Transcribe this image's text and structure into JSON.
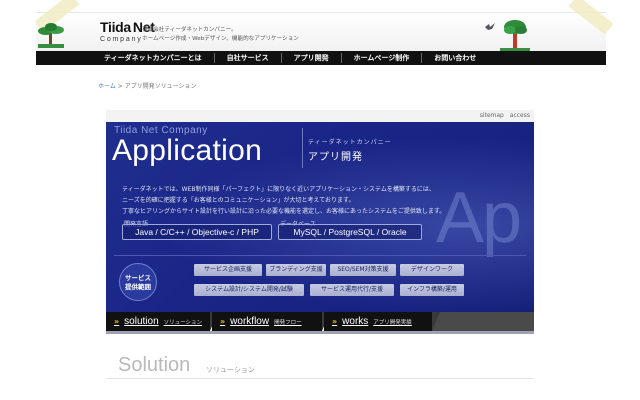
{
  "header": {
    "logo_main_1": "Tiida",
    "logo_main_2": "Net",
    "logo_sub": "Company",
    "tagline_1": "有限会社ティーダネットカンパニー。",
    "tagline_2": "ホームページ作成・Webデザイン、機能的なアプリケーション"
  },
  "nav": {
    "items": [
      "ティーダネットカンパニーとは",
      "自社サービス",
      "アプリ開発",
      "ホームページ制作",
      "お問い合わせ"
    ]
  },
  "breadcrumb": {
    "home": "ホーム",
    "separator": " > ",
    "current": "アプリ開発ソリューション"
  },
  "hero": {
    "utility_links": [
      "sitemap",
      "access"
    ],
    "brand": "Tiida Net Company",
    "title": "Application",
    "subtitle_kana": "ティーダネットカンパニー",
    "subtitle": "アプリ開発",
    "watermark": "Ap",
    "description": [
      "ティーダネットでは、WEB制作同様「パーフェクト」に限りなく近いアプリケーション・システムを構築するには、",
      "ニーズを的確に把握する「お客様とのコミュニケーション」が大切と考えております。",
      "丁寧なヒアリングからサイト設計を行い設計に沿った必要な機能を選定し、お客様にあったシステムをご提供致します。"
    ],
    "languages_label": "開発言語",
    "languages": "Java / C/C++ / Objective-c / PHP",
    "database_label": "データベース",
    "database": "MySQL / PostgreSQL / Oracle",
    "service_badge_1": "サービス",
    "service_badge_2": "提供範囲",
    "services_row1": [
      "サービス企画支援",
      "ブランディング支援",
      "SEO/SEM対策支援",
      "デザインワーク"
    ],
    "services_row2": [
      "システム設計/システム開発/試験",
      "サービス運用代行/支援",
      "インフラ構築/運用"
    ]
  },
  "tabs": [
    {
      "en": "solution",
      "jp": "ソリューション"
    },
    {
      "en": "workflow",
      "jp": "開発フロー"
    },
    {
      "en": "works",
      "jp": "アプリ開発実績"
    }
  ],
  "section": {
    "title": "Solution",
    "title_jp": "ソリューション"
  },
  "colors": {
    "hero_blue": "#1a2687",
    "nav_black": "#111111",
    "accent_yellow": "#f2c21a",
    "link_blue": "#4a7ec0"
  }
}
